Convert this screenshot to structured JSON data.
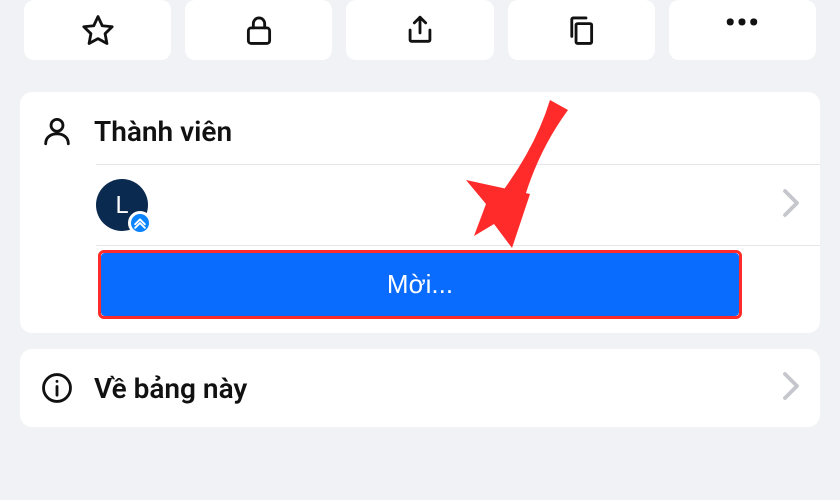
{
  "toolbar": {
    "items": [
      {
        "name": "star-icon"
      },
      {
        "name": "lock-icon"
      },
      {
        "name": "share-icon"
      },
      {
        "name": "copy-icon"
      },
      {
        "name": "more-icon"
      }
    ]
  },
  "members": {
    "title": "Thành viên",
    "list": [
      {
        "initial": "L",
        "admin_badge": true
      }
    ],
    "invite_label": "Mời..."
  },
  "about": {
    "label": "Về bảng này"
  },
  "annotation": {
    "arrow": true,
    "highlight_color": "#ff2a2a"
  }
}
